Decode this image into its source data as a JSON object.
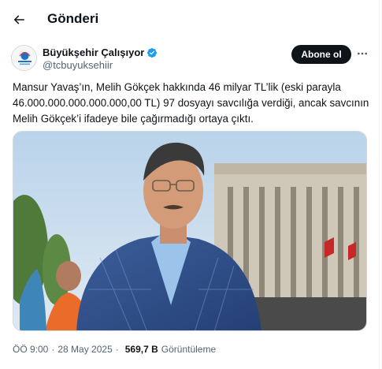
{
  "header": {
    "title": "Gönderi",
    "back_icon": "arrow-left-icon"
  },
  "author": {
    "display_name": "Büyükşehir Çalışıyor",
    "handle": "@tcbuyuksehiir",
    "verified": true,
    "verified_color": "#1d9bf0",
    "avatar_logo_text": "Büyükşehir Çalışıyor"
  },
  "actions": {
    "follow_label": "Abone ol",
    "more_icon": "more-horizontal-icon"
  },
  "tweet": {
    "text": "Mansur Yavaş’ın, Melih Gökçek hakkında 46 milyar TL’lik (eski parayla 46.000.000.000.000.000,00 TL) 97 dosyayı savcılığa verdiği, ancak savcının Melih Gökçek’i ifadeye bile çağırmadığı ortaya çıktı."
  },
  "meta": {
    "time": "ÖÖ 9:00",
    "date": "28 May 2025",
    "separator": "·",
    "views_count": "569,7 B",
    "views_label": "Görüntüleme"
  },
  "colors": {
    "text_primary": "#0f1419",
    "text_secondary": "#536471",
    "border": "#cfd9de",
    "accent": "#1d9bf0"
  }
}
